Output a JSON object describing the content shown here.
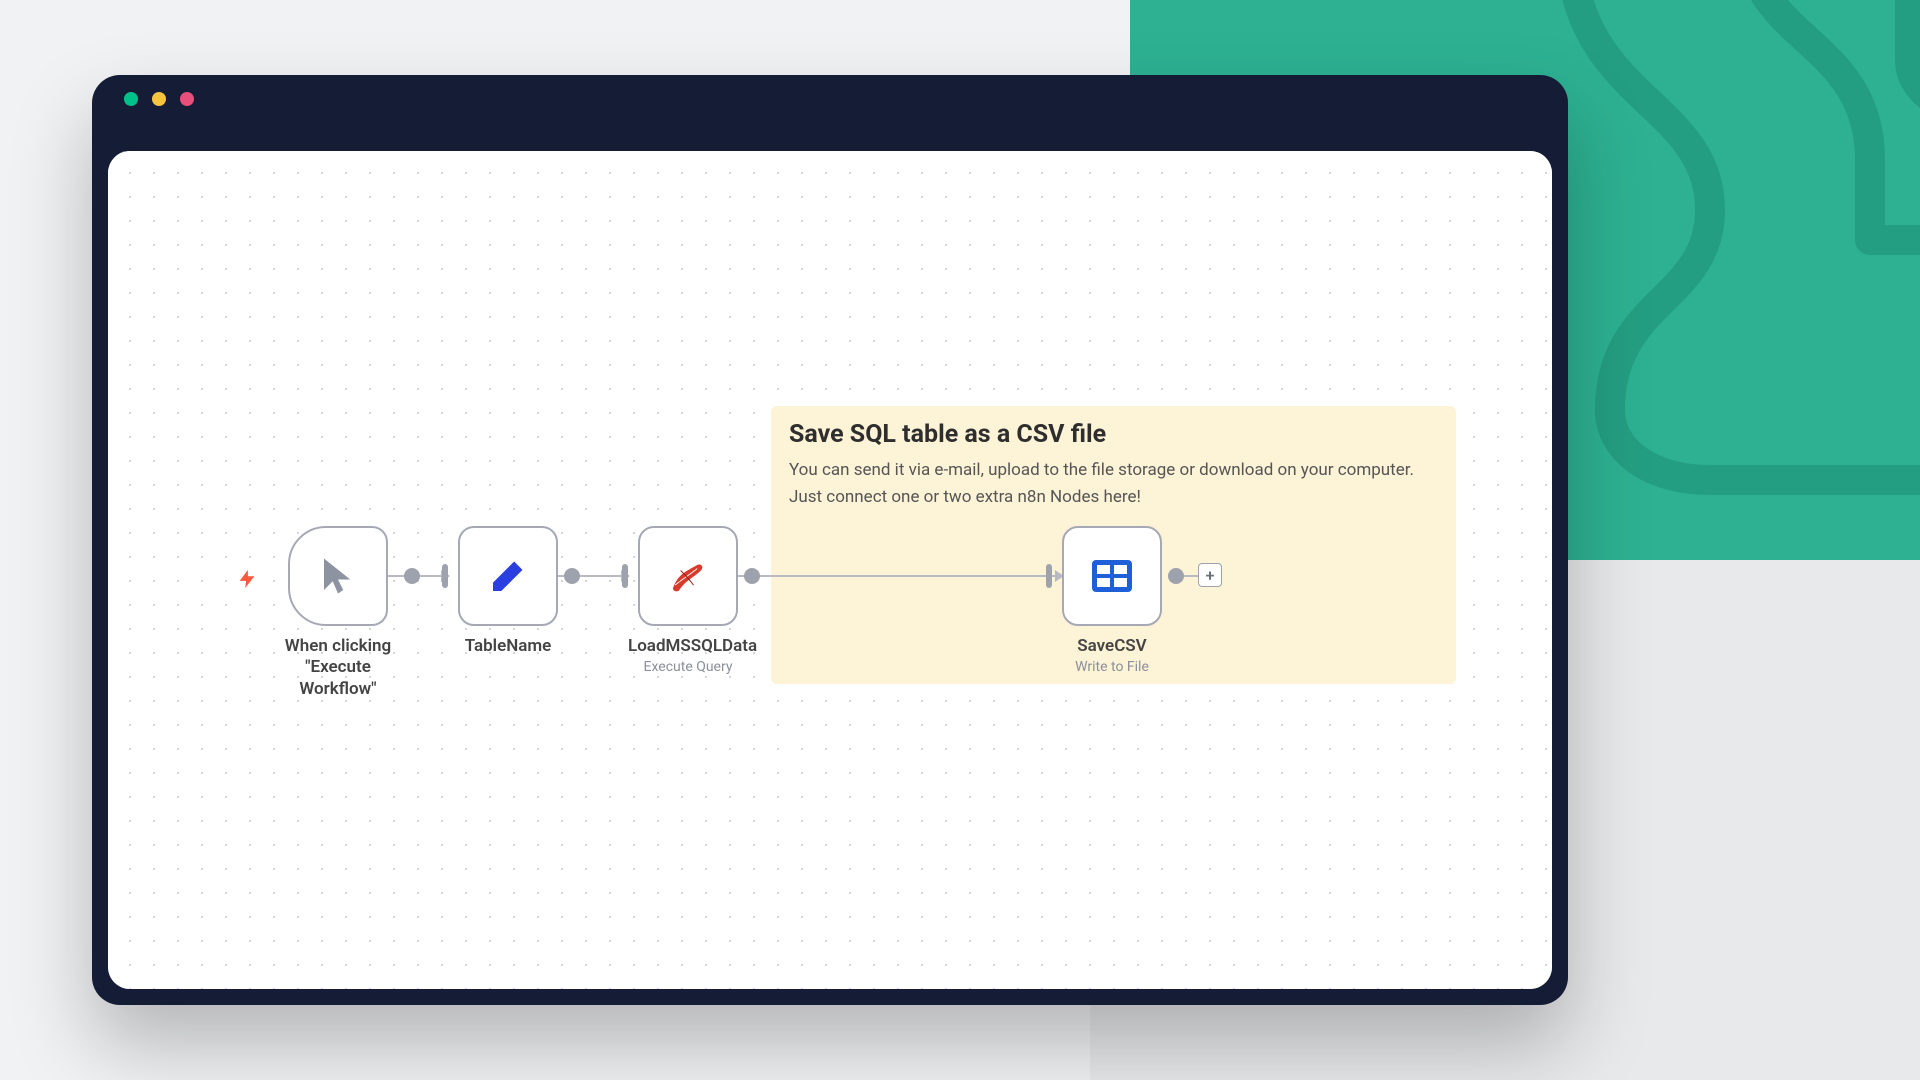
{
  "sticky": {
    "title": "Save SQL table as a CSV file",
    "line1": "You can send it via e-mail, upload to the file storage or download on your computer.",
    "line2": "Just connect one or two extra n8n Nodes here!"
  },
  "nodes": {
    "trigger": {
      "label": "When clicking \"Execute Workflow\""
    },
    "tablename": {
      "label": "TableName"
    },
    "loadmssql": {
      "label": "LoadMSSQLData",
      "sub": "Execute Query"
    },
    "savecsv": {
      "label": "SaveCSV",
      "sub": "Write to File"
    }
  },
  "plus": "+"
}
